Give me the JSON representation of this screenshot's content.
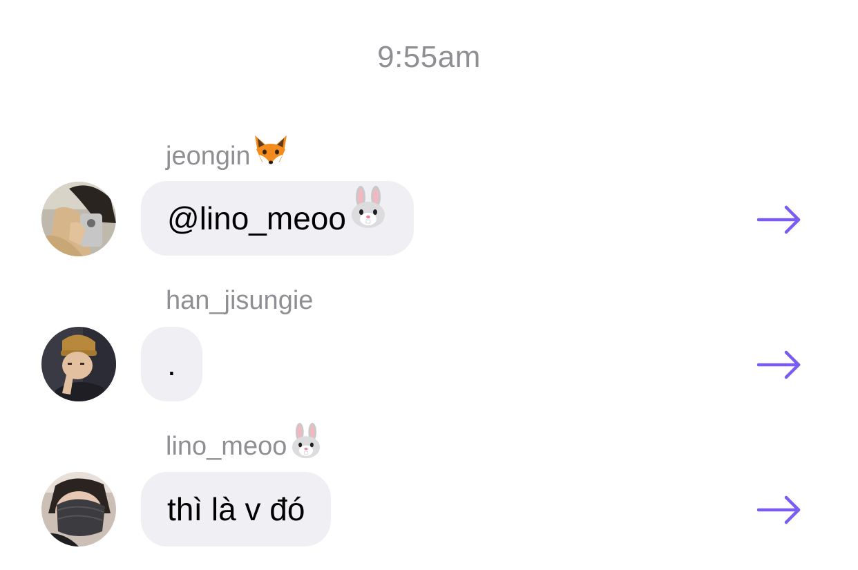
{
  "timestamp": "9:55am",
  "messages": [
    {
      "sender": "jeongin",
      "sender_emoji": "fox-face-emoji",
      "text": "@lino_meoo",
      "text_emoji": "rabbit-face-emoji"
    },
    {
      "sender": "han_jisungie",
      "sender_emoji": "",
      "text": ".",
      "text_emoji": ""
    },
    {
      "sender": "lino_meoo",
      "sender_emoji": "rabbit-face-emoji",
      "text": "thì là v đó",
      "text_emoji": ""
    }
  ],
  "colors": {
    "accent": "#7b5cf0",
    "bubble": "#efeff4",
    "secondary_text": "#8e8e93"
  },
  "icons": {
    "forward": "arrow-right-icon"
  }
}
